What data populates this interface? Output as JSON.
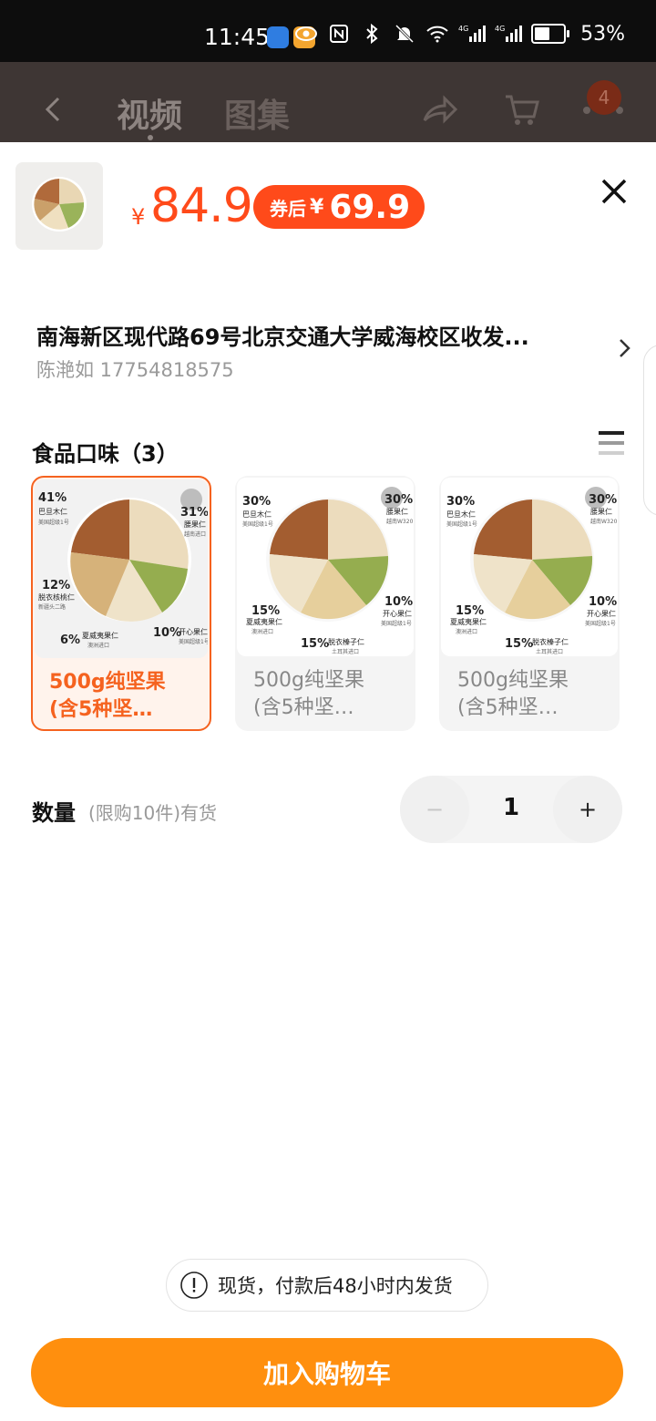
{
  "status_bar": {
    "time": "11:45",
    "network_label": "4G",
    "battery": "53%"
  },
  "header": {
    "tabs": [
      {
        "label": "视频"
      },
      {
        "label": "图集"
      }
    ],
    "cart_count": "4"
  },
  "product": {
    "currency": "¥",
    "price": "84.9",
    "coupon_label": "券后",
    "coupon_price": "69.9",
    "thumbnail_icon": "mixed-nuts-thumbnail"
  },
  "address": {
    "line": "南海新区现代路69号北京交通大学威海校区收发...",
    "contact": "陈滟如 17754818575"
  },
  "flavor": {
    "title": "食品口味（3）",
    "options": [
      {
        "label": "500g纯坚果\n(含5种坚…",
        "selected": true
      },
      {
        "label": "500g纯坚果\n(含5种坚…",
        "selected": false
      },
      {
        "label": "500g纯坚果\n(含5种坚…",
        "selected": false
      }
    ],
    "image_labels_1": {
      "a_pct": "41%",
      "a_name": "巴旦木仁",
      "a_sub": "美国超级1号",
      "b_pct": "31%",
      "b_name": "腰果仁",
      "b_sub": "越南进口",
      "c_pct": "12%",
      "c_name": "脱衣核桃仁",
      "c_sub": "新疆头二路",
      "d_pct": "6%",
      "d_name": "夏威夷果仁",
      "d_sub": "澳洲进口",
      "e_pct": "10%",
      "e_name": "开心果仁",
      "e_sub": "美国超级1号"
    },
    "image_labels_2": {
      "a_pct": "30%",
      "a_name": "巴旦木仁",
      "a_sub": "美国超级1号",
      "b_pct": "30%",
      "b_name": "腰果仁",
      "b_sub": "越南W320",
      "c_pct": "15%",
      "c_name": "夏威夷果仁",
      "c_sub": "澳洲进口",
      "d_pct": "15%",
      "d_name": "脱衣榛子仁",
      "d_sub": "土耳其进口",
      "e_pct": "10%",
      "e_name": "开心果仁",
      "e_sub": "美国超级1号"
    },
    "colors": {
      "selected": "#f5621f"
    }
  },
  "quantity": {
    "label": "数量",
    "note": "(限购10件)有货",
    "value": "1",
    "minus": "−",
    "plus": "+"
  },
  "shipping_notice": "现货，付款后48小时内发货",
  "add_to_cart": "加入购物车",
  "colors": {
    "accent": "#ff4a1a",
    "cta": "#ff8f0e"
  }
}
